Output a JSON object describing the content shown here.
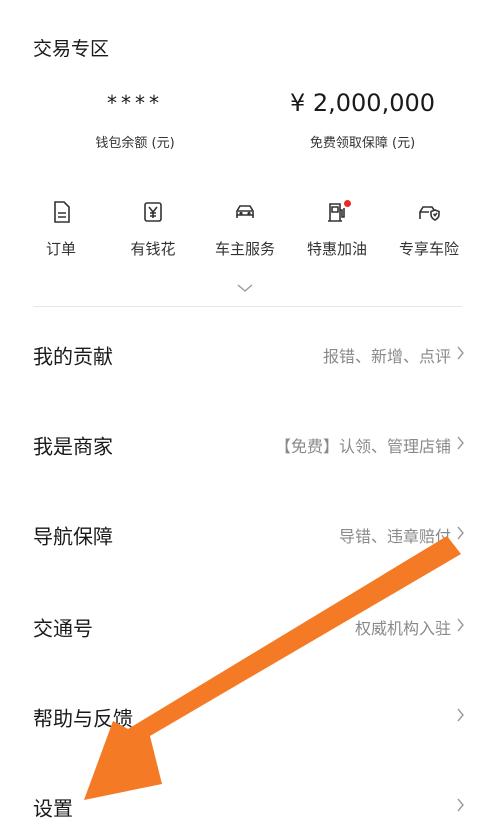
{
  "section": {
    "title": "交易专区"
  },
  "wallet": {
    "value": "****",
    "label": "钱包余额 (元)"
  },
  "guarantee": {
    "value": "¥ 2,000,000",
    "label": "免费领取保障 (元)"
  },
  "shortcuts": [
    {
      "label": "订单",
      "icon": "order-document-icon"
    },
    {
      "label": "有钱花",
      "icon": "yen-card-icon"
    },
    {
      "label": "车主服务",
      "icon": "car-icon"
    },
    {
      "label": "特惠加油",
      "icon": "fuel-pump-icon",
      "badge": "red-dot"
    },
    {
      "label": "专享车险",
      "icon": "car-insurance-icon"
    }
  ],
  "menu": [
    {
      "title": "我的贡献",
      "desc": "报错、新增、点评"
    },
    {
      "title": "我是商家",
      "desc": "【免费】认领、管理店铺"
    },
    {
      "title": "导航保障",
      "desc": "导错、违章赔付"
    },
    {
      "title": "交通号",
      "desc": "权威机构入驻"
    },
    {
      "title": "帮助与反馈",
      "desc": ""
    },
    {
      "title": "设置",
      "desc": ""
    }
  ],
  "colors": {
    "accent_arrow": "#f47a25",
    "badge": "#e82a2a",
    "muted_text": "#8a8a8a"
  }
}
